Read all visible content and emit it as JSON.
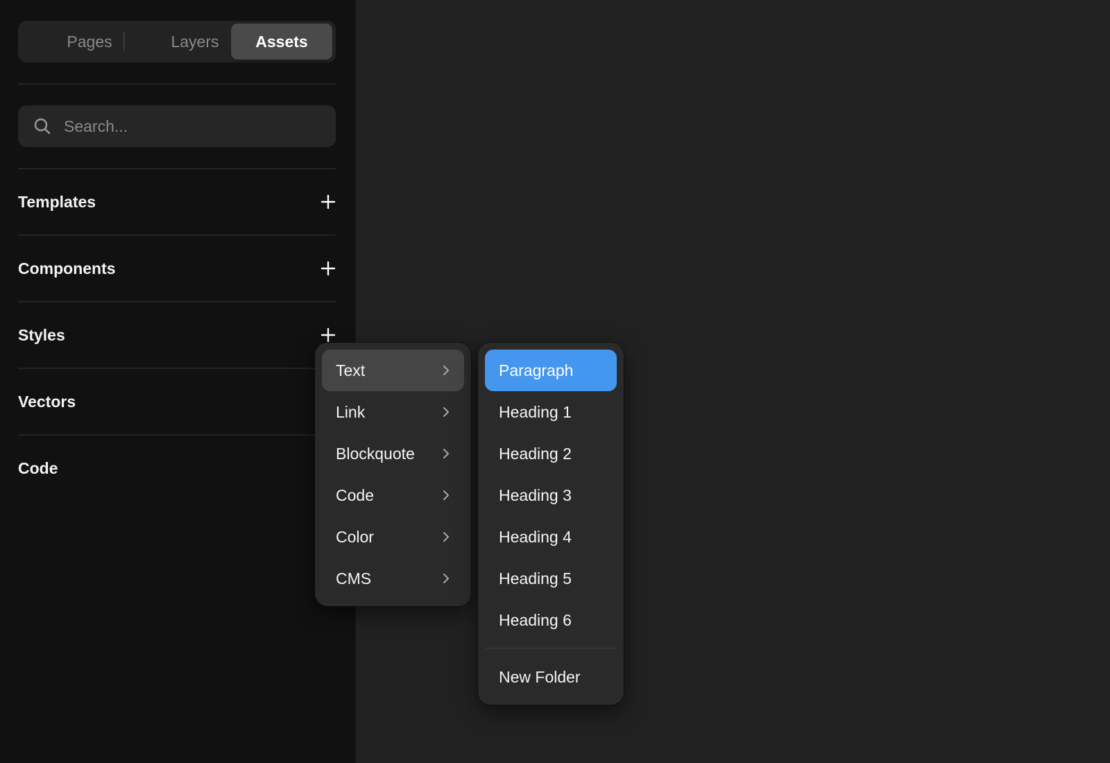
{
  "tabs": [
    {
      "label": "Pages",
      "selected": false
    },
    {
      "label": "Layers",
      "selected": false
    },
    {
      "label": "Assets",
      "selected": true
    }
  ],
  "search": {
    "placeholder": "Search...",
    "value": ""
  },
  "sections": [
    {
      "label": "Templates",
      "has_add": true
    },
    {
      "label": "Components",
      "has_add": true
    },
    {
      "label": "Styles",
      "has_add": true
    },
    {
      "label": "Vectors",
      "has_add": false
    },
    {
      "label": "Code",
      "has_add": false
    }
  ],
  "style_menu": {
    "items": [
      {
        "label": "Text",
        "active": true,
        "icon": "chevron-right-icon"
      },
      {
        "label": "Link",
        "active": false,
        "icon": "chevron-right-icon"
      },
      {
        "label": "Blockquote",
        "active": false,
        "icon": "chevron-right-icon"
      },
      {
        "label": "Code",
        "active": false,
        "icon": "chevron-right-icon"
      },
      {
        "label": "Color",
        "active": false,
        "icon": "chevron-right-icon"
      },
      {
        "label": "CMS",
        "active": false,
        "icon": "chevron-right-icon"
      }
    ]
  },
  "text_submenu": {
    "items": [
      {
        "label": "Paragraph",
        "highlighted": true
      },
      {
        "label": "Heading 1",
        "highlighted": false
      },
      {
        "label": "Heading 2",
        "highlighted": false
      },
      {
        "label": "Heading 3",
        "highlighted": false
      },
      {
        "label": "Heading 4",
        "highlighted": false
      },
      {
        "label": "Heading 5",
        "highlighted": false
      },
      {
        "label": "Heading 6",
        "highlighted": false
      }
    ],
    "footer_item": "New Folder"
  },
  "colors": {
    "canvas_bg": "#212121",
    "sidebar_bg": "#111111",
    "menu_bg": "#2a2a2a",
    "highlight": "#4596ee"
  }
}
